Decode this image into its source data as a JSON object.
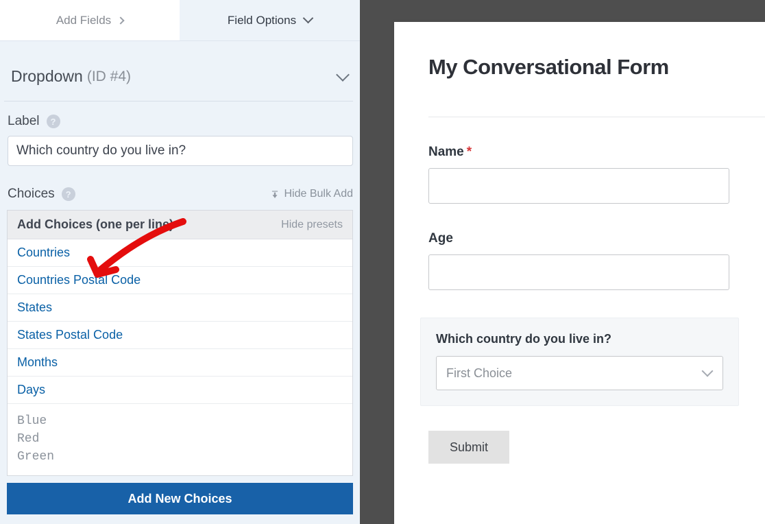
{
  "tabs": {
    "add_fields": "Add Fields",
    "field_options": "Field Options"
  },
  "section": {
    "title": "Dropdown",
    "id": "(ID #4)"
  },
  "label": {
    "caption": "Label",
    "value": "Which country do you live in?"
  },
  "choices": {
    "caption": "Choices",
    "hide_bulk": "Hide Bulk Add",
    "add_choices_header": "Add Choices (one per line)",
    "hide_presets": "Hide presets",
    "presets": [
      "Countries",
      "Countries Postal Code",
      "States",
      "States Postal Code",
      "Months",
      "Days"
    ],
    "textarea_value": "Blue\nRed\nGreen",
    "add_btn": "Add New Choices"
  },
  "preview": {
    "title": "My Conversational Form",
    "name_label": "Name",
    "required_marker": "*",
    "age_label": "Age",
    "dropdown_label": "Which country do you live in?",
    "dropdown_value": "First Choice",
    "submit": "Submit"
  }
}
